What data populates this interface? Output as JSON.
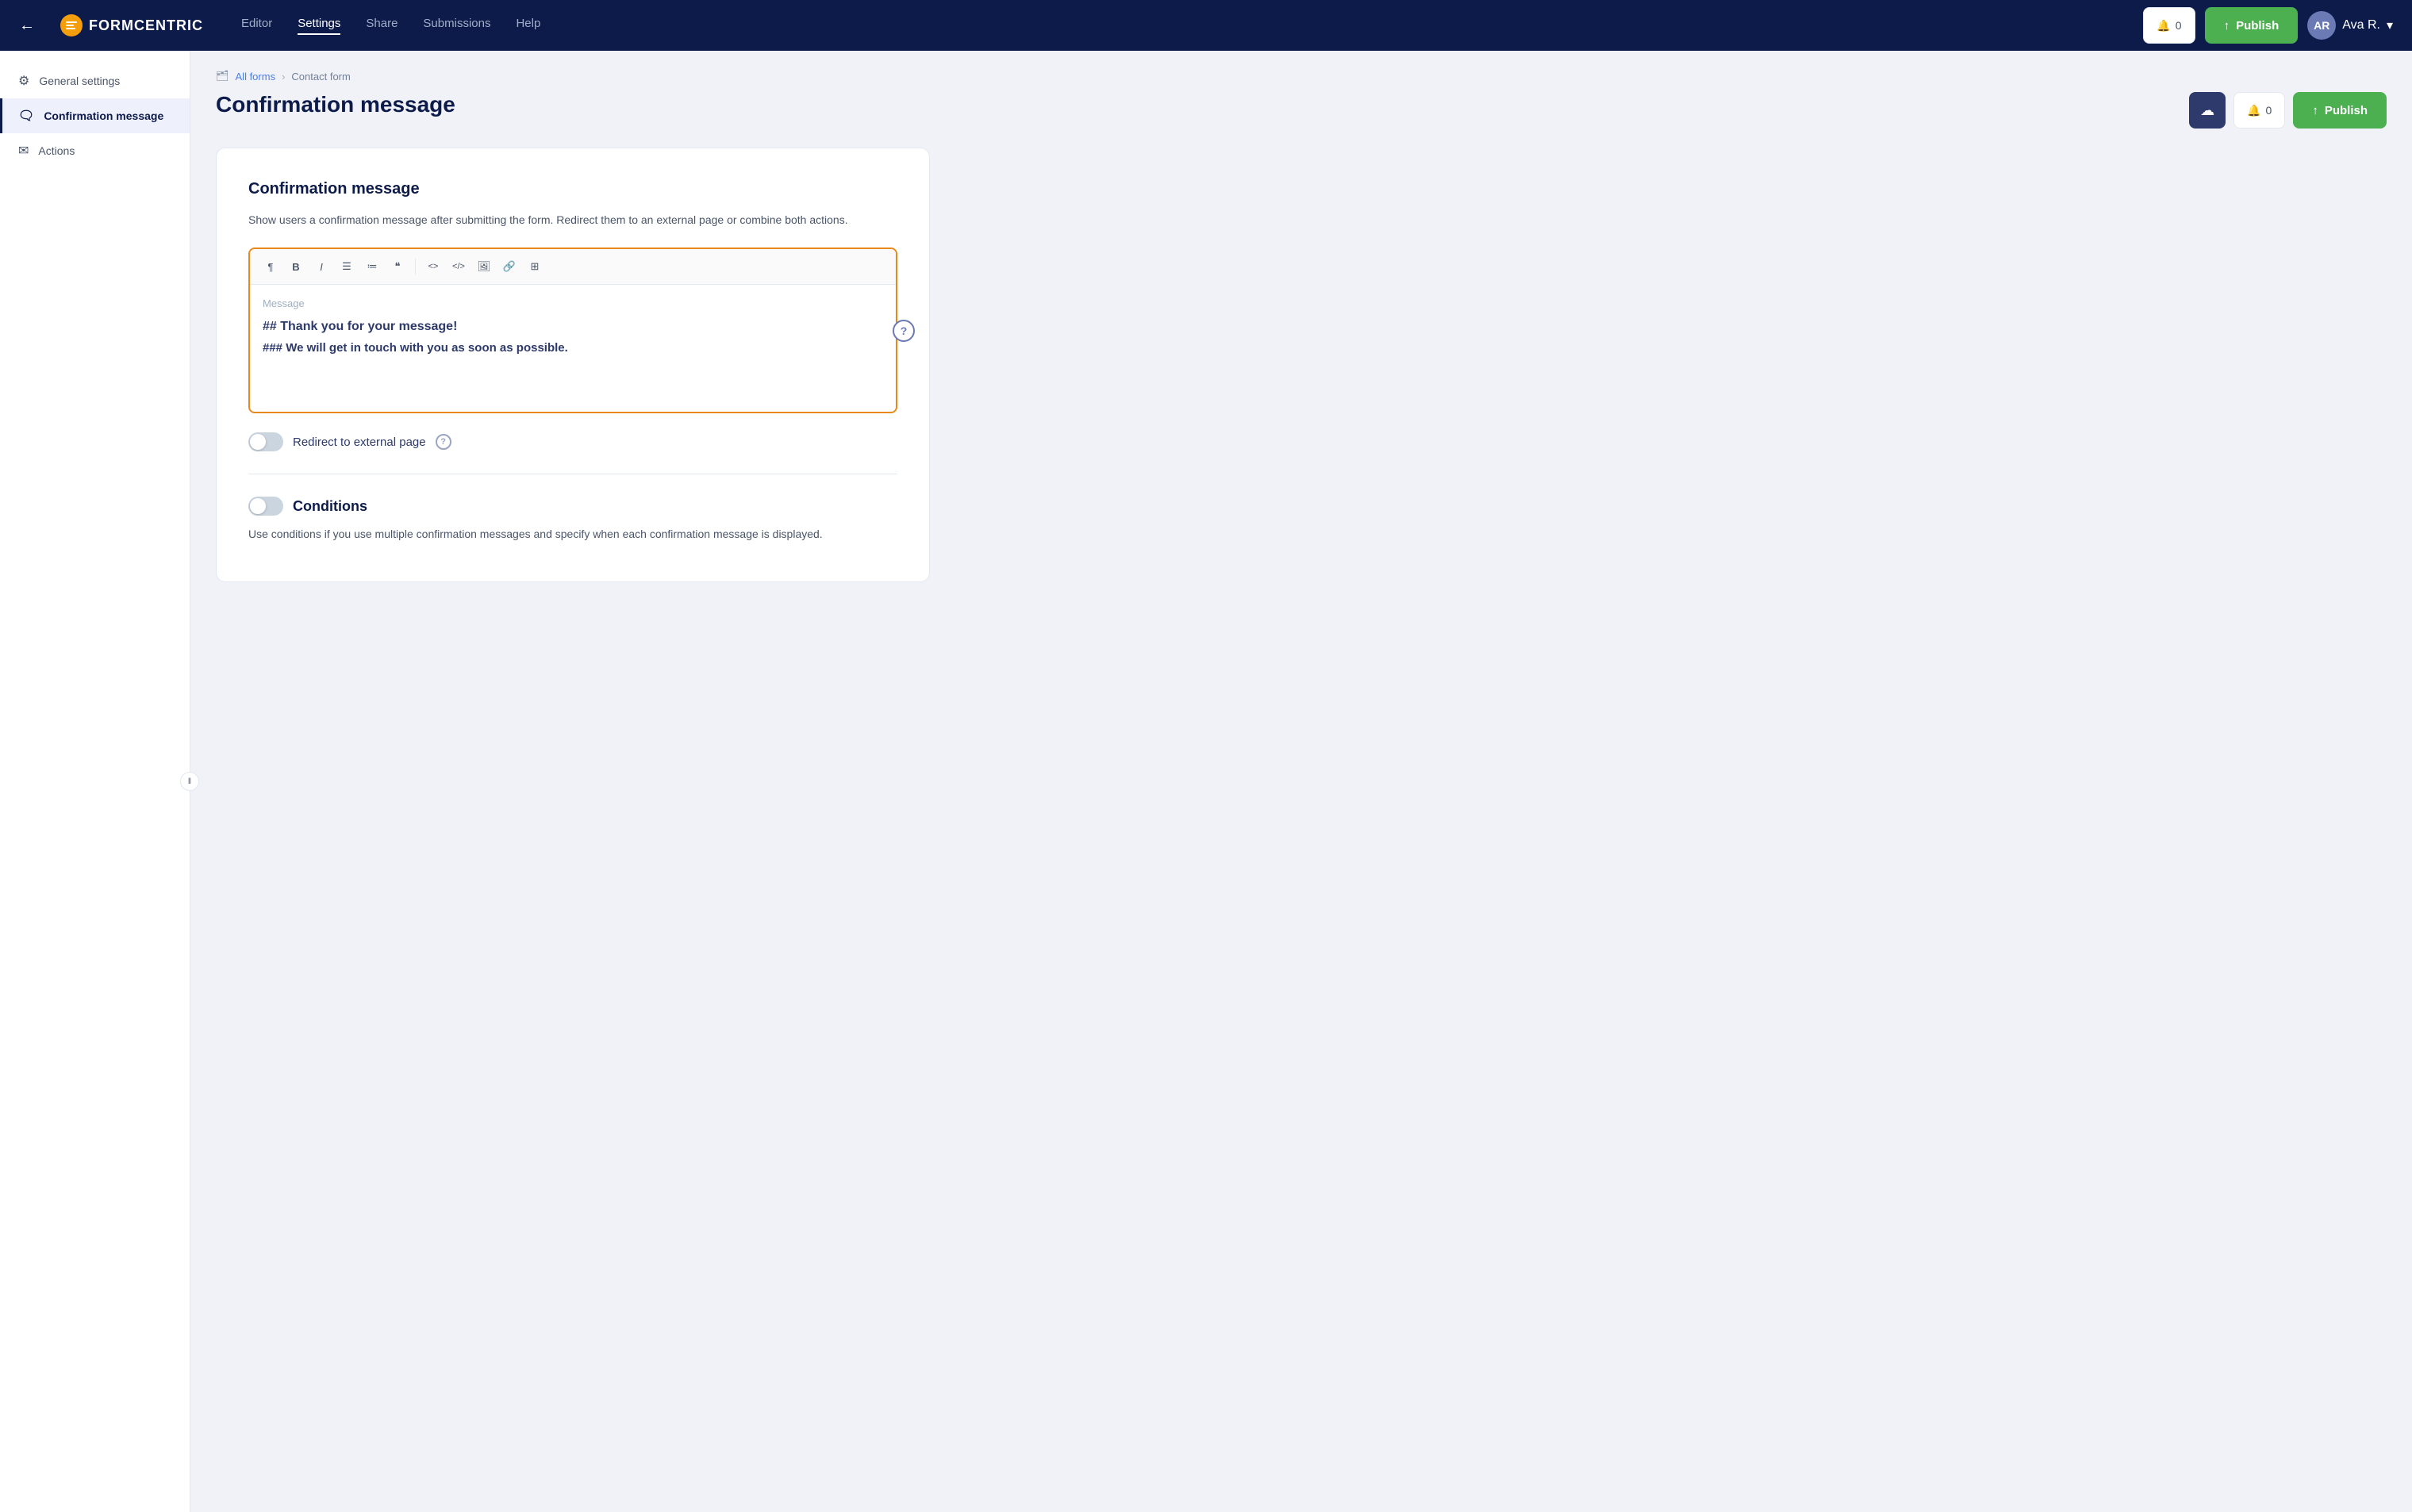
{
  "topnav": {
    "back_icon": "←",
    "logo_text": "FORMCENTRIC",
    "links": [
      {
        "label": "Editor",
        "active": false
      },
      {
        "label": "Settings",
        "active": true
      },
      {
        "label": "Share",
        "active": false
      },
      {
        "label": "Submissions",
        "active": false
      },
      {
        "label": "Help",
        "active": false
      }
    ],
    "notify_count": "0",
    "publish_label": "Publish",
    "user_name": "Ava R.",
    "user_initials": "AR"
  },
  "sidebar": {
    "items": [
      {
        "id": "general-settings",
        "label": "General settings",
        "icon": "⚙",
        "active": false
      },
      {
        "id": "confirmation-message",
        "label": "Confirmation message",
        "icon": "🗨",
        "active": true
      },
      {
        "id": "actions",
        "label": "Actions",
        "icon": "✉",
        "active": false
      }
    ]
  },
  "breadcrumb": {
    "forms_label": "All forms",
    "form_name": "Contact form",
    "separator": "›"
  },
  "page": {
    "title": "Confirmation message"
  },
  "section": {
    "title": "Confirmation message",
    "description": "Show users a confirmation message after submitting the form. Redirect them to an external page or combine both actions.",
    "editor": {
      "placeholder": "Message",
      "line1": "## Thank you for your message!",
      "line2": "### We will get in touch with you as soon as possible."
    },
    "redirect_toggle_label": "Redirect to external page",
    "conditions_label": "Conditions",
    "conditions_description": "Use conditions if you use multiple confirmation messages and specify when each confirmation message is displayed."
  },
  "toolbar": {
    "buttons": [
      {
        "id": "paragraph",
        "symbol": "¶",
        "title": "Paragraph"
      },
      {
        "id": "bold",
        "symbol": "B",
        "title": "Bold"
      },
      {
        "id": "italic",
        "symbol": "I",
        "title": "Italic"
      },
      {
        "id": "bullet-list",
        "symbol": "≡",
        "title": "Bullet list"
      },
      {
        "id": "ordered-list",
        "symbol": "⋮",
        "title": "Ordered list"
      },
      {
        "id": "blockquote",
        "symbol": "❝",
        "title": "Blockquote"
      },
      {
        "id": "code-inline",
        "symbol": "<>",
        "title": "Inline code"
      },
      {
        "id": "code-block",
        "symbol": "</>",
        "title": "Code block"
      },
      {
        "id": "image",
        "symbol": "🖼",
        "title": "Image"
      },
      {
        "id": "link",
        "symbol": "🔗",
        "title": "Link"
      },
      {
        "id": "table",
        "symbol": "⊞",
        "title": "Table"
      }
    ]
  }
}
